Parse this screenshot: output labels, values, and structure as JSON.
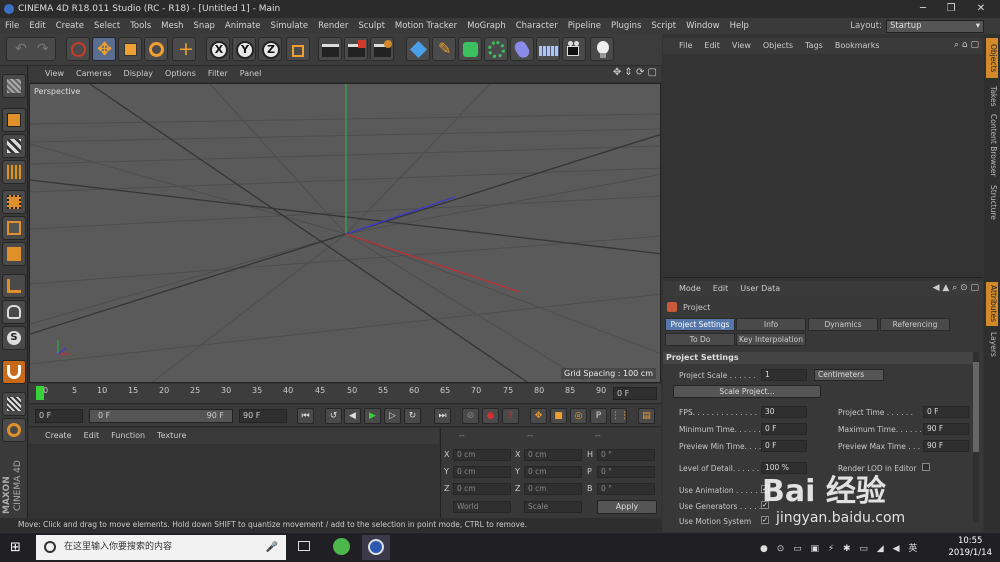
{
  "window": {
    "title": "CINEMA 4D R18.011 Studio (RC - R18) - [Untitled 1] - Main",
    "minimize": "─",
    "maximize": "❐",
    "close": "✕"
  },
  "menubar": {
    "items": [
      "File",
      "Edit",
      "Create",
      "Select",
      "Tools",
      "Mesh",
      "Snap",
      "Animate",
      "Simulate",
      "Render",
      "Sculpt",
      "Motion Tracker",
      "MoGraph",
      "Character",
      "Pipeline",
      "Plugins",
      "Script",
      "Window",
      "Help"
    ],
    "layout_label": "Layout:",
    "layout_value": "Startup"
  },
  "viewport": {
    "menu": [
      "View",
      "Cameras",
      "Display",
      "Options",
      "Filter",
      "Panel"
    ],
    "label": "Perspective",
    "grid_spacing": "Grid Spacing : 100 cm"
  },
  "timeline": {
    "ticks": [
      "0",
      "5",
      "10",
      "15",
      "20",
      "25",
      "30",
      "35",
      "40",
      "45",
      "50",
      "55",
      "60",
      "65",
      "70",
      "75",
      "80",
      "85",
      "90"
    ],
    "current_frame": "0 F"
  },
  "transport": {
    "start": "0 F",
    "range_start": "0 F",
    "range_end": "90 F",
    "end": "90 F"
  },
  "material_menu": [
    "Create",
    "Edit",
    "Function",
    "Texture"
  ],
  "coordinates": {
    "headers": [
      "--",
      "--",
      "--"
    ],
    "rows": [
      {
        "l1": "X",
        "v1": "0 cm",
        "l2": "X",
        "v2": "0 cm",
        "l3": "H",
        "v3": "0 °"
      },
      {
        "l1": "Y",
        "v1": "0 cm",
        "l2": "Y",
        "v2": "0 cm",
        "l3": "P",
        "v3": "0 °"
      },
      {
        "l1": "Z",
        "v1": "0 cm",
        "l2": "Z",
        "v2": "0 cm",
        "l3": "B",
        "v3": "0 °"
      }
    ],
    "mode1": "World",
    "mode2": "Scale",
    "apply": "Apply"
  },
  "status": "Move: Click and drag to move elements. Hold down SHIFT to quantize movement / add to the selection in point mode, CTRL to remove.",
  "objects_menu": [
    "File",
    "Edit",
    "View",
    "Objects",
    "Tags",
    "Bookmarks"
  ],
  "right_tabs": [
    "Objects",
    "Takes",
    "Content Browser",
    "Structure",
    "Attributes",
    "Layers"
  ],
  "attributes": {
    "menu": [
      "Mode",
      "Edit",
      "User Data"
    ],
    "title": "Project",
    "tabs": [
      "Project Settings",
      "Info",
      "Dynamics",
      "Referencing",
      "To Do",
      "Key Interpolation"
    ],
    "section": "Project Settings",
    "project_scale_label": "Project Scale . . . . . .",
    "project_scale_value": "1",
    "project_scale_unit": "Centimeters",
    "scale_button": "Scale Project...",
    "fps_label": "FPS. . . . . . . . . . . . . .",
    "fps_value": "30",
    "project_time_label": "Project Time . . . . . .",
    "project_time_value": "0 F",
    "min_time_label": "Minimum Time. . . . . .",
    "min_time_value": "0 F",
    "max_time_label": "Maximum Time. . . . . .",
    "max_time_value": "90 F",
    "prev_min_label": "Preview Min Time. . . .",
    "prev_min_value": "0 F",
    "prev_max_label": "Preview Max Time . . .",
    "prev_max_value": "90 F",
    "lod_label": "Level of Detail. . . . . .",
    "lod_value": "100 %",
    "render_lod_label": "Render LOD in Editor",
    "use_animation_label": "Use Animation . . . . . .",
    "use_generators_label": "Use Generators . . . . .",
    "use_motion_label": "Use Motion System"
  },
  "watermark": {
    "logo": "Bai 经验",
    "sub": "jingyan.baidu.com"
  },
  "taskbar": {
    "search_placeholder": "在这里输入你要搜索的内容",
    "time": "10:55",
    "date": "2019/1/14"
  },
  "maxon": {
    "brand": "MAXON",
    "product": "CINEMA 4D"
  }
}
